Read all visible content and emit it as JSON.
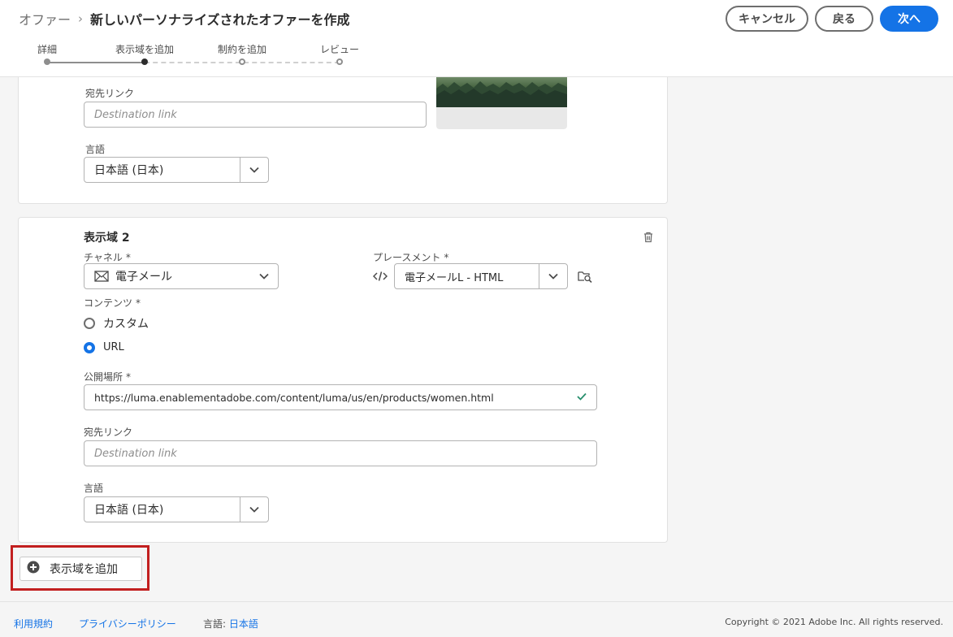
{
  "header": {
    "breadcrumb_parent": "オファー",
    "breadcrumb_separator": "›",
    "title": "新しいパーソナライズされたオファーを作成",
    "cancel_label": "キャンセル",
    "back_label": "戻る",
    "next_label": "次へ"
  },
  "steps": [
    {
      "label": "詳細",
      "state": "done"
    },
    {
      "label": "表示域を追加",
      "state": "current"
    },
    {
      "label": "制約を追加",
      "state": "future"
    },
    {
      "label": "レビュー",
      "state": "future"
    }
  ],
  "representation1": {
    "destination_label": "宛先リンク",
    "destination_placeholder": "Destination link",
    "language_label": "言語",
    "language_value": "日本語 (日本)"
  },
  "representation2": {
    "title": "表示域 2",
    "channel_label": "チャネル",
    "channel_value": "電子メール",
    "placement_label": "プレースメント",
    "placement_value": "電子メールL - HTML",
    "required_mark": "*",
    "content_label": "コンテンツ",
    "option_custom": "カスタム",
    "option_url": "URL",
    "selected_option": "URL",
    "public_location_label": "公開場所",
    "public_location_value": "https://luma.enablementadobe.com/content/luma/us/en/products/women.html",
    "destination_label": "宛先リンク",
    "destination_placeholder": "Destination link",
    "language_label": "言語",
    "language_value": "日本語 (日本)"
  },
  "add_representation_label": "表示域を追加",
  "footer": {
    "terms": "利用規約",
    "privacy": "プライバシーポリシー",
    "language_label": "言語:",
    "language_value": "日本語",
    "copyright": "Copyright ©  2021 Adobe Inc.  All rights reserved."
  },
  "colors": {
    "accent": "#1473e6",
    "highlight_border": "#c21f1f",
    "valid_check": "#268e6c"
  },
  "icons": [
    "chevron-right-icon",
    "chevron-down-icon",
    "email-icon",
    "code-icon",
    "folder-search-icon",
    "trash-icon",
    "checkmark-icon",
    "add-circle-icon"
  ]
}
